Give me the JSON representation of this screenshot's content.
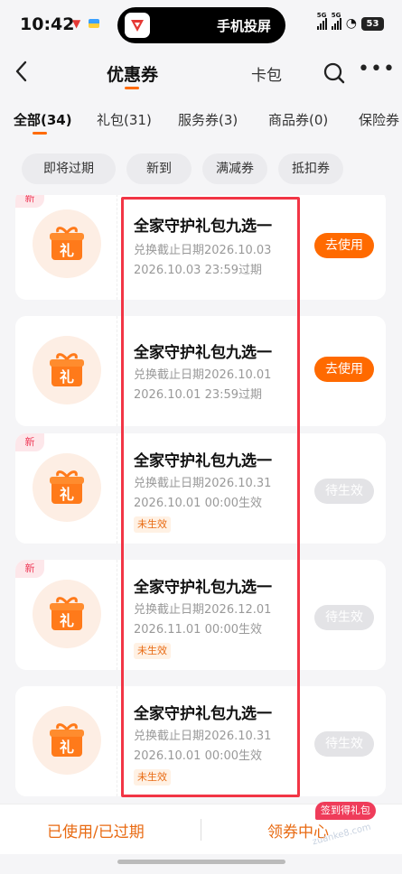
{
  "status_bar": {
    "time": "10:42",
    "island_text": "手机投屏",
    "signal1_tag": "5G",
    "signal2_tag": "5G",
    "battery": "53"
  },
  "header": {
    "title": "优惠券",
    "card_bag": "卡包",
    "back_icon": "chevron-left-icon",
    "search_icon": "search-icon",
    "more_icon": "more-icon"
  },
  "tabs": [
    {
      "label": "全部(34)",
      "active": true
    },
    {
      "label": "礼包(31)"
    },
    {
      "label": "服务券(3)"
    },
    {
      "label": "商品券(0)"
    },
    {
      "label": "保险券"
    }
  ],
  "chips": [
    "即将过期",
    "新到",
    "满减券",
    "抵扣券"
  ],
  "coupons": [
    {
      "new": "新",
      "name": "全家守护礼包九选一",
      "line1": "兑换截止日期2026.10.03",
      "line2": "2026.10.03 23:59过期",
      "status": "",
      "action": "去使用"
    },
    {
      "new": "",
      "name": "全家守护礼包九选一",
      "line1": "兑换截止日期2026.10.01",
      "line2": "2026.10.01 23:59过期",
      "status": "",
      "action": "去使用"
    },
    {
      "new": "新",
      "name": "全家守护礼包九选一",
      "line1": "兑换截止日期2026.10.31",
      "line2": "2026.10.01 00:00生效",
      "status": "未生效",
      "action": "待生效"
    },
    {
      "new": "新",
      "name": "全家守护礼包九选一",
      "line1": "兑换截止日期2026.12.01",
      "line2": "2026.11.01 00:00生效",
      "status": "未生效",
      "action": "待生效"
    },
    {
      "new": "",
      "name": "全家守护礼包九选一",
      "line1": "兑换截止日期2026.10.31",
      "line2": "2026.10.01 00:00生效",
      "status": "未生效",
      "action": "待生效"
    }
  ],
  "gift_char": "礼",
  "bottom": {
    "used_expired": "已使用/已过期",
    "coupon_center": "领券中心",
    "sign_badge": "签到得礼包",
    "watermark": "zuanke8.com"
  },
  "colors": {
    "accent": "#ff6a00",
    "highlight": "#f23545"
  }
}
